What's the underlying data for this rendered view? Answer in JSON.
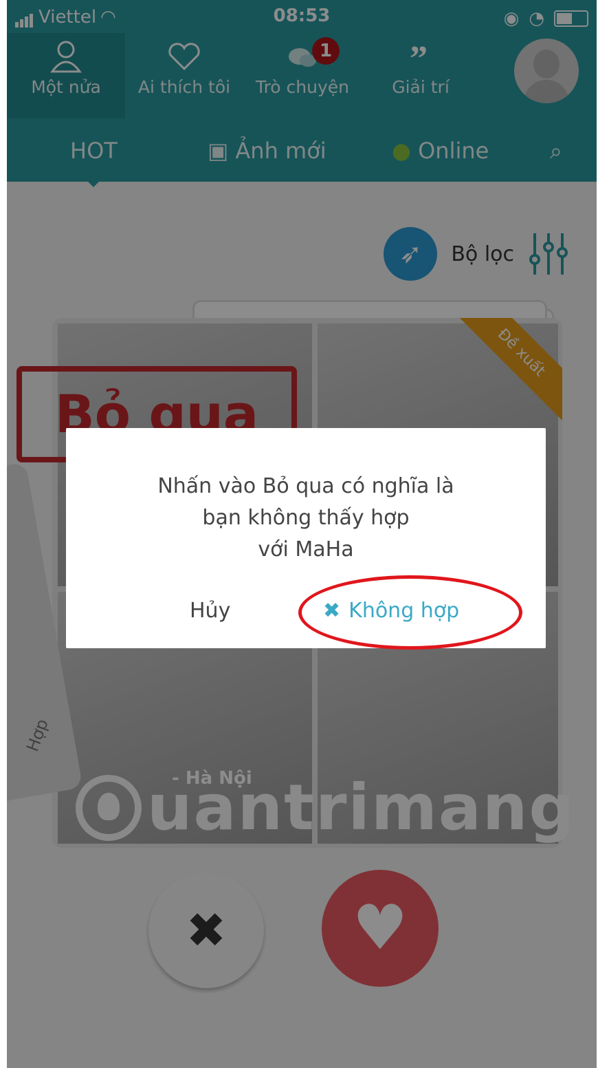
{
  "status": {
    "carrier": "Viettel",
    "time": "08:53"
  },
  "nav": {
    "tabs": [
      {
        "label": "Một nửa",
        "icon": "users-icon"
      },
      {
        "label": "Ai thích tôi",
        "icon": "heart-outline-icon"
      },
      {
        "label": "Trò chuyện",
        "icon": "chat-icon",
        "badge": "1"
      },
      {
        "label": "Giải trí",
        "icon": "quote-icon"
      }
    ]
  },
  "subtabs": {
    "hot": "HOT",
    "new_photos": "Ảnh mới",
    "online": "Online"
  },
  "filter": {
    "label": "Bộ lọc"
  },
  "card": {
    "ribbon": "Đề xuất",
    "skip_stamp": "Bỏ qua",
    "location": "- Hà Nội",
    "side_label": "Hợp"
  },
  "watermark": "uantrimang",
  "dialog": {
    "message_lines": [
      "Nhấn vào Bỏ qua có nghĩa là",
      "bạn không thấy hợp",
      "với MaHa"
    ],
    "cancel": "Hủy",
    "confirm": "Không hợp"
  },
  "colors": {
    "header": "#2b9aa0",
    "accent": "#3aa9c6",
    "highlight": "#e0161c"
  }
}
